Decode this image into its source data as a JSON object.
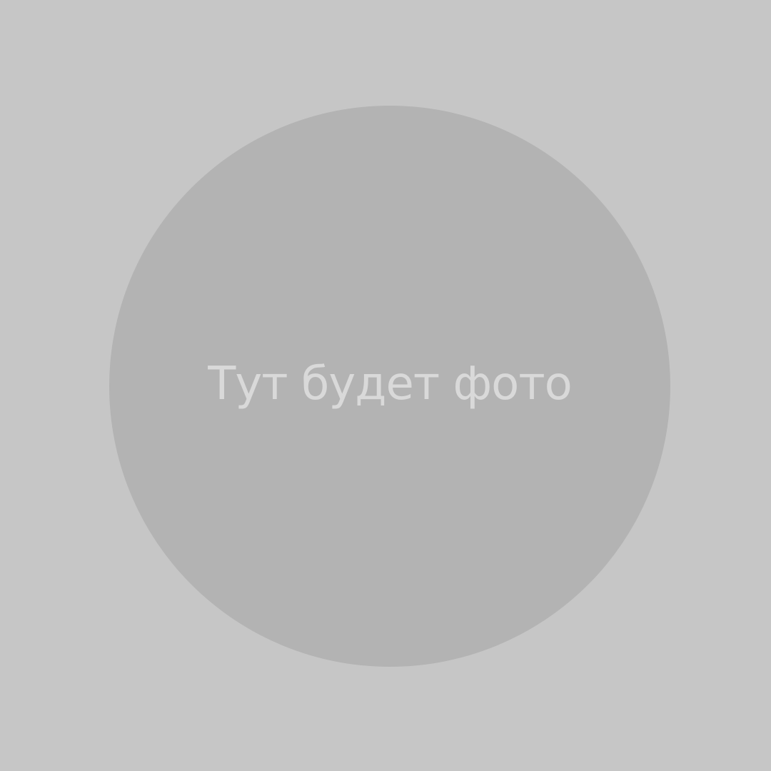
{
  "placeholder": {
    "text": "Тут будет фото"
  },
  "colors": {
    "background": "#c6c6c6",
    "circle": "#b3b3b3",
    "text": "#d9d9d9"
  }
}
